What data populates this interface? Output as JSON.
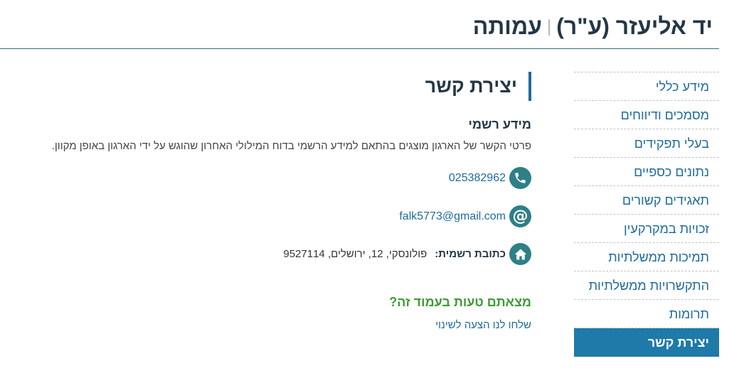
{
  "header": {
    "org_name": "יד אליעזר (ע\"ר)",
    "separator": "|",
    "org_type": "עמותה"
  },
  "sidebar": {
    "items": [
      {
        "label": "מידע כללי"
      },
      {
        "label": "מסמכים ודיווחים"
      },
      {
        "label": "בעלי תפקידים"
      },
      {
        "label": "נתונים כספיים"
      },
      {
        "label": "תאגידים קשורים"
      },
      {
        "label": "זכויות במקרקעין"
      },
      {
        "label": "תמיכות ממשלתיות"
      },
      {
        "label": "התקשרויות ממשלתיות"
      },
      {
        "label": "תרומות"
      },
      {
        "label": "יצירת קשר"
      }
    ],
    "active_index": 9
  },
  "main": {
    "section_title": "יצירת קשר",
    "official_info_title": "מידע רשמי",
    "description": "פרטי הקשר של הארגון מוצגים בהתאם למידע הרשמי בדוח המילולי האחרון שהוגש על ידי הארגון באופן מקוון.",
    "phone": "025382962",
    "email": "falk5773@gmail.com",
    "address_label": "כתובת רשמית:",
    "address_value": "פולונסקי, 12, ירושלים, 9527114",
    "error_title": "מצאתם טעות בעמוד זה?",
    "error_link": "שלחו לנו הצעה לשינוי"
  },
  "icons": {
    "phone": "phone-icon",
    "email": "at-sign-icon",
    "address": "home-icon"
  },
  "colors": {
    "accent": "#1e7aa8",
    "icon_bg": "#2e7f86",
    "link": "#1e6b9c",
    "heading": "#233746",
    "error_green": "#3d9b35"
  }
}
